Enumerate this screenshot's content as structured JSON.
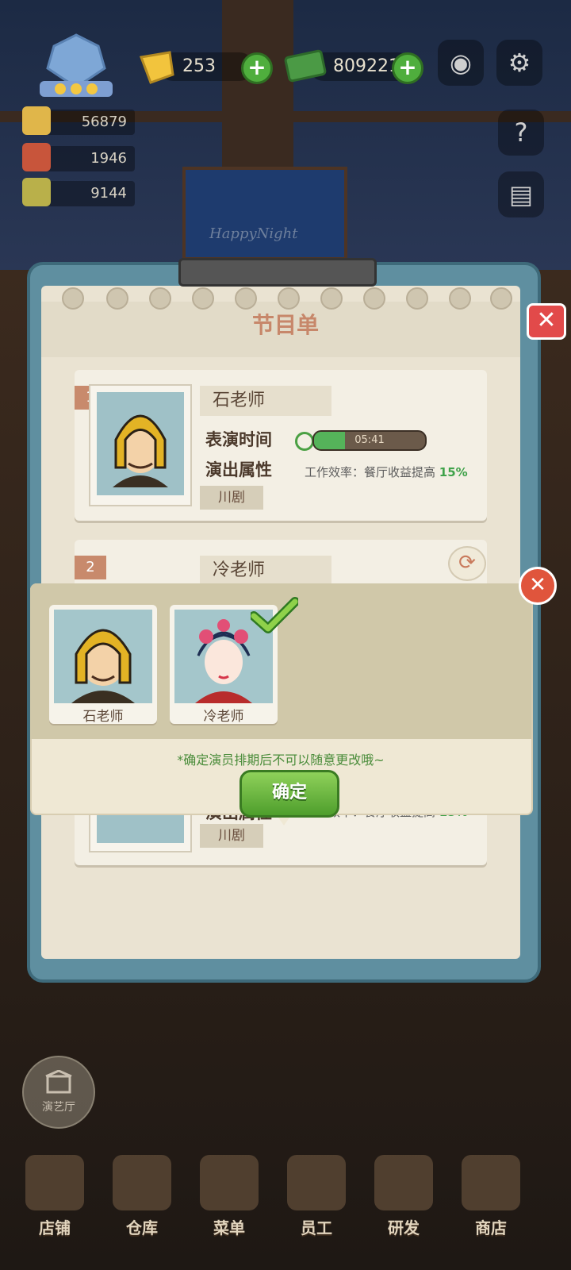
{
  "hud": {
    "gems": "253",
    "cash": "809221",
    "res1": "56879",
    "res2": "1946",
    "res3": "9144"
  },
  "stage_sign": "HappyNight",
  "panel": {
    "title": "节目单",
    "cards": [
      {
        "index": "1",
        "name": "石老师",
        "time_label": "表演时间",
        "time_value": "05:41",
        "time_progress": 0.28,
        "attr_label": "演出属性",
        "attr_text": "工作效率：餐厅收益提高",
        "attr_pct": "15%",
        "tag": "川剧"
      },
      {
        "index": "2",
        "name": "冷老师",
        "attr_label": "演出属性",
        "attr_text": "工作效率：餐厅收益提高",
        "attr_pct": "15%",
        "tag": "川剧"
      }
    ]
  },
  "popup": {
    "actors": [
      {
        "name": "石老师",
        "selected": false
      },
      {
        "name": "冷老师",
        "selected": true
      }
    ],
    "notice": "*确定演员排期后不可以随意更改哦~",
    "confirm": "确定"
  },
  "side_badge": "演艺厅",
  "nav": [
    "店铺",
    "仓库",
    "菜单",
    "员工",
    "研发",
    "商店"
  ],
  "colors": {
    "accent_green": "#4fae3d",
    "close_red": "#e24a4a",
    "title": "#c7876a"
  }
}
